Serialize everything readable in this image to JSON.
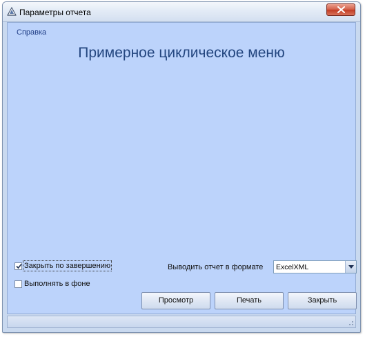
{
  "window": {
    "title": "Параметры отчета",
    "close_icon": "close-icon"
  },
  "menu": {
    "help_label": "Справка"
  },
  "main": {
    "heading": "Примерное циклическое меню"
  },
  "options": {
    "close_on_finish_label": "Закрыть по завершению",
    "close_on_finish_checked": true,
    "run_in_background_label": "Выполнять в фоне",
    "run_in_background_checked": false
  },
  "output": {
    "format_label": "Выводить отчет в формате",
    "format_value": "ExcelXML"
  },
  "buttons": {
    "preview_label": "Просмотр",
    "print_label": "Печать",
    "close_label": "Закрыть"
  },
  "colors": {
    "client_background": "#bcd3fb",
    "heading": "#23467f",
    "link": "#1f3d86"
  }
}
